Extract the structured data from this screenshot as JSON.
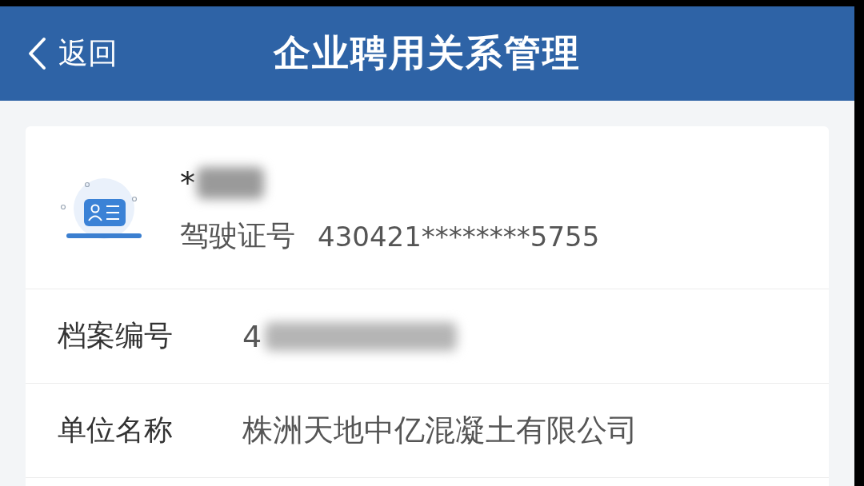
{
  "header": {
    "back_label": "返回",
    "title": "企业聘用关系管理"
  },
  "profile": {
    "name": "*",
    "name_redacted": true,
    "license_label": "驾驶证号",
    "license_number": "430421********5755"
  },
  "rows": [
    {
      "label": "档案编号",
      "value": "4",
      "redacted": true
    },
    {
      "label": "单位名称",
      "value": "株洲天地中亿混凝土有限公司",
      "redacted": false
    }
  ]
}
